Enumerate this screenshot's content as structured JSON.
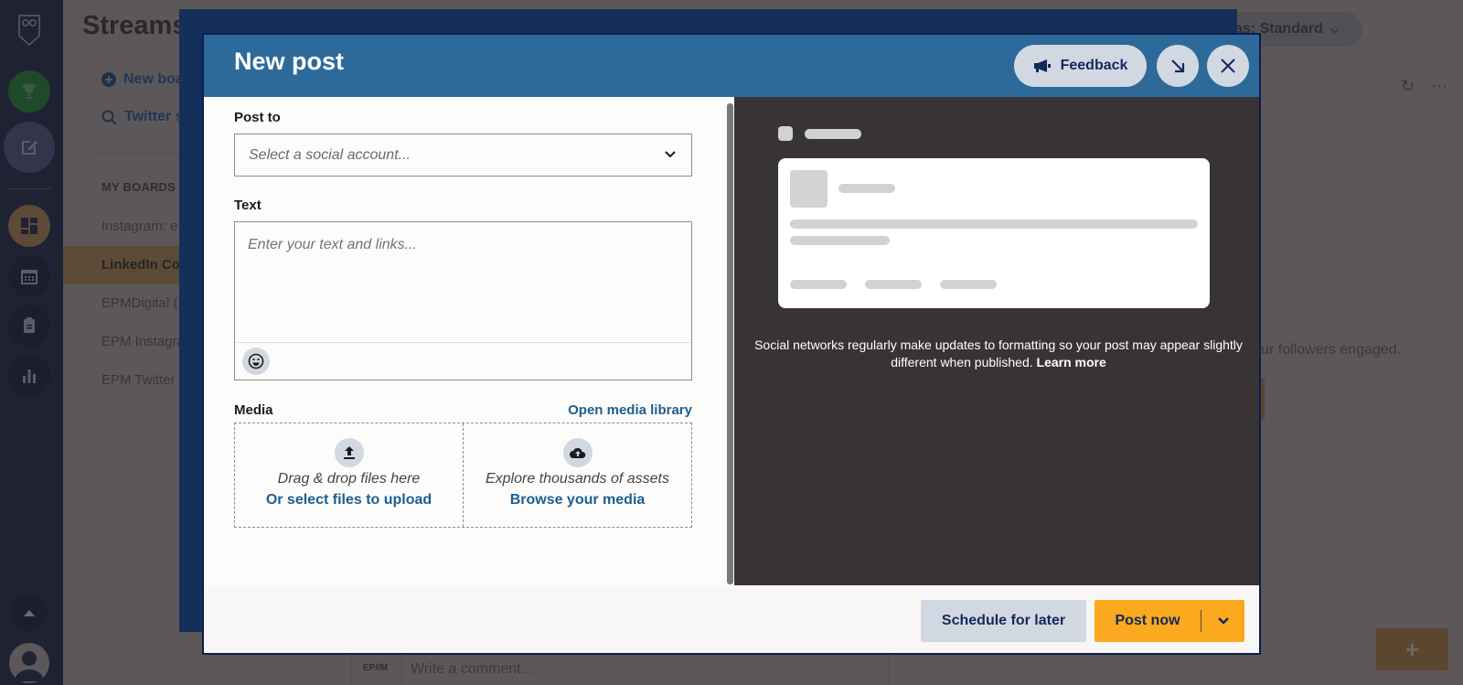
{
  "background": {
    "sidebar": {
      "title": "Streams",
      "actions": [
        {
          "label": "New board",
          "icon": "plus-circle-icon"
        },
        {
          "label": "Twitter search",
          "icon": "search-icon"
        }
      ],
      "boards_header": "MY BOARDS",
      "boards": [
        {
          "label": "Instagram: e",
          "active": false
        },
        {
          "label": "LinkedIn Co",
          "active": true
        },
        {
          "label": "EPMDigital (",
          "active": false
        },
        {
          "label": "EPM Instagra",
          "active": false
        },
        {
          "label": "EPM Twitter",
          "active": false
        }
      ]
    },
    "rail_icons": [
      "owl-logo-icon",
      "trophy-icon",
      "compose-icon",
      "dashboard-icon",
      "calendar-icon",
      "clipboard-icon",
      "analytics-icon",
      "expand-up-icon",
      "profile-avatar-icon"
    ],
    "view_selector": "as: Standard",
    "empty_state_title": "..",
    "empty_state_text": "ep your followers engaged.",
    "add_button": "+",
    "comment_logo": "EP//M",
    "comment_placeholder": "Write a comment..."
  },
  "modal": {
    "title": "New post",
    "feedback_label": "Feedback",
    "post_to": {
      "label": "Post to",
      "placeholder": "Select a social account..."
    },
    "text": {
      "label": "Text",
      "placeholder": "Enter your text and links..."
    },
    "media": {
      "label": "Media",
      "open_library": "Open media library",
      "upload": {
        "subtitle": "Drag & drop files here",
        "link": "Or select files to upload"
      },
      "browse": {
        "subtitle": "Explore thousands of assets",
        "link": "Browse your media"
      }
    },
    "preview": {
      "note": "Social networks regularly make updates to formatting so your post may appear slightly different when published.",
      "learn_more": "Learn more"
    },
    "footer": {
      "schedule": "Schedule for later",
      "post_now": "Post now"
    },
    "colors": {
      "header": "#2d6a9a",
      "primary": "#fba91e",
      "secondary": "#d2d8e2",
      "link": "#1e5e8f",
      "preview_bg": "#383435"
    }
  }
}
